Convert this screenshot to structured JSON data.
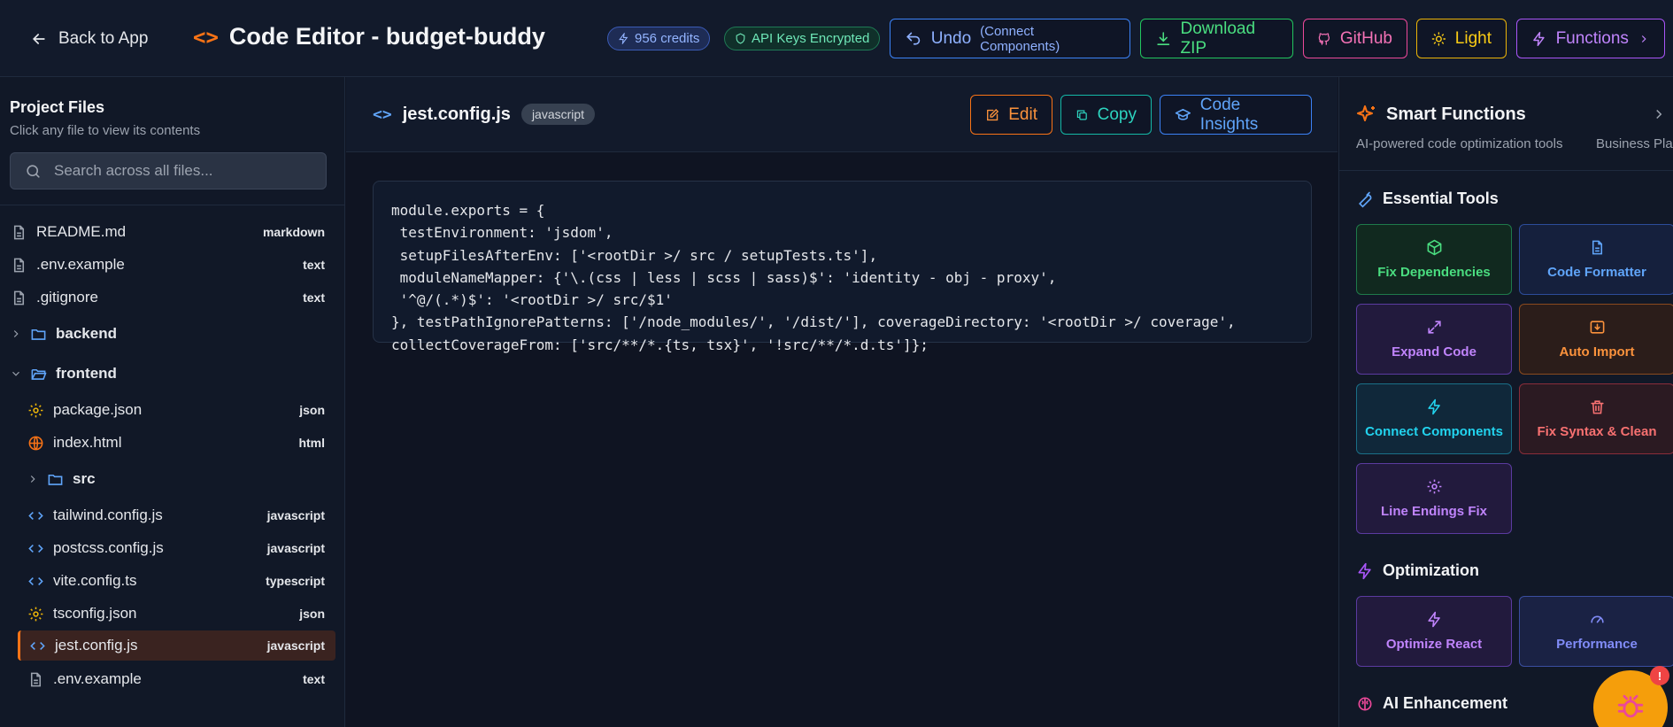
{
  "header": {
    "back_label": "Back to App",
    "title": "Code Editor - budget-buddy",
    "credits": "956 credits",
    "api_keys": "API Keys Encrypted",
    "undo_label": "Undo",
    "undo_sub": "(Connect Components)",
    "download_label": "Download ZIP",
    "github_label": "GitHub",
    "theme_label": "Light",
    "functions_label": "Functions"
  },
  "sidebar": {
    "title": "Project Files",
    "subtitle": "Click any file to view its contents",
    "search_placeholder": "Search across all files...",
    "items": [
      {
        "label": "README.md",
        "tag": "markdown",
        "icon": "file-icon"
      },
      {
        "label": ".env.example",
        "tag": "text",
        "icon": "file-icon"
      },
      {
        "label": ".gitignore",
        "tag": "text",
        "icon": "file-icon"
      },
      {
        "label": "backend",
        "icon": "folder-icon",
        "expanded": false
      },
      {
        "label": "frontend",
        "icon": "folder-open-icon",
        "expanded": true
      },
      {
        "label": "package.json",
        "tag": "json",
        "icon": "gear-icon"
      },
      {
        "label": "index.html",
        "tag": "html",
        "icon": "globe-icon"
      },
      {
        "label": "src",
        "icon": "folder-icon",
        "expanded": false
      },
      {
        "label": "tailwind.config.js",
        "tag": "javascript",
        "icon": "code-icon"
      },
      {
        "label": "postcss.config.js",
        "tag": "javascript",
        "icon": "code-icon"
      },
      {
        "label": "vite.config.ts",
        "tag": "typescript",
        "icon": "code-icon"
      },
      {
        "label": "tsconfig.json",
        "tag": "json",
        "icon": "gear-icon"
      },
      {
        "label": "jest.config.js",
        "tag": "javascript",
        "icon": "code-icon",
        "selected": true
      },
      {
        "label": ".env.example",
        "tag": "text",
        "icon": "file-icon"
      }
    ]
  },
  "editor": {
    "file_name": "jest.config.js",
    "language": "javascript",
    "edit_label": "Edit",
    "copy_label": "Copy",
    "insights_label": "Code Insights",
    "code": "module.exports = {\n testEnvironment: 'jsdom',\n setupFilesAfterEnv: ['<rootDir >/ src / setupTests.ts'],\n moduleNameMapper: {'\\.(css | less | scss | sass)$': 'identity - obj - proxy',\n '^@/(.*)$': '<rootDir >/ src/$1'\n}, testPathIgnorePatterns: ['/node_modules/', '/dist/'], coverageDirectory: '<rootDir >/ coverage',\ncollectCoverageFrom: ['src/**/*.{ts, tsx}', '!src/**/*.d.ts']};"
  },
  "smart_functions": {
    "title": "Smart Functions",
    "subtitle": "AI-powered code optimization tools",
    "subtitle2": "Business Plan",
    "sections": {
      "essential": "Essential Tools",
      "optimization": "Optimization",
      "ai": "AI Enhancement"
    },
    "tools": {
      "fix_deps": "Fix Dependencies",
      "formatter": "Code Formatter",
      "expand": "Expand Code",
      "auto_import": "Auto Import",
      "connect": "Connect Components",
      "fix_syntax": "Fix Syntax & Clean",
      "line_endings": "Line Endings Fix",
      "optimize_react": "Optimize React",
      "performance": "Performance"
    }
  },
  "fab": {
    "badge": "!"
  },
  "colors": {
    "accent_orange": "#f97316",
    "accent_blue": "#3b82f6",
    "accent_green": "#22c55e",
    "accent_purple": "#a855f7"
  }
}
